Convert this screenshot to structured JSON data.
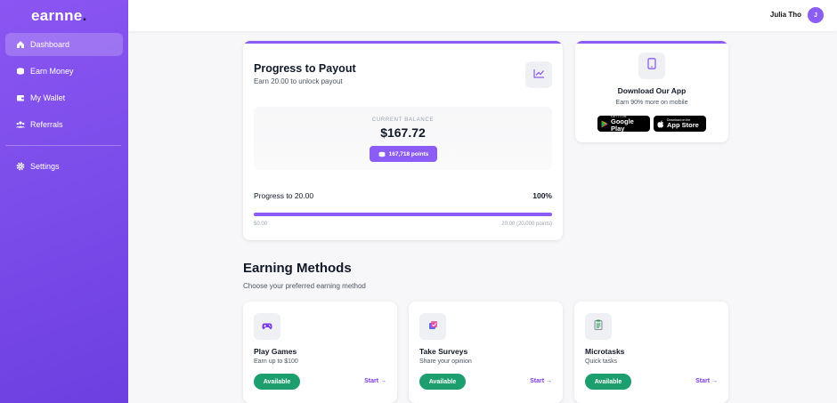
{
  "brand": {
    "name": "earnne",
    "dot": ".",
    "accent": "#8b5cf6",
    "success": "#1d9e6f"
  },
  "sidebar": {
    "items": [
      {
        "label": "Dashboard",
        "icon": "home-icon",
        "active": true
      },
      {
        "label": "Earn Money",
        "icon": "coins-icon",
        "active": false
      },
      {
        "label": "My Wallet",
        "icon": "wallet-icon",
        "active": false
      },
      {
        "label": "Referrals",
        "icon": "users-icon",
        "active": false
      },
      {
        "label": "Settings",
        "icon": "gear-icon",
        "active": false
      }
    ]
  },
  "header": {
    "user_name": "Julia Tho",
    "avatar_initial": "J"
  },
  "payout": {
    "title": "Progress to Payout",
    "subtitle": "Earn 20.00 to unlock payout",
    "balance_label": "CURRENT BALANCE",
    "balance_value": "$167.72",
    "points": "167,718 points",
    "progress_label": "Progress to 20.00",
    "progress_percent": "100%",
    "progress_fraction": 1.0,
    "range_min": "$0.00",
    "range_max": "20.00 (20,000 points)"
  },
  "app": {
    "title": "Download Our App",
    "subtitle": "Earn 90% more on mobile",
    "google_small": "GET IT ON",
    "google_big": "Google Play",
    "apple_small": "Download on the",
    "apple_big": "App Store"
  },
  "methods": {
    "title": "Earning Methods",
    "subtitle": "Choose your preferred earning method",
    "items": [
      {
        "title": "Play Games",
        "subtitle": "Earn up to $100",
        "badge": "Available",
        "action": "Start →",
        "icon": "gamepad-icon"
      },
      {
        "title": "Take Surveys",
        "subtitle": "Share your opinion",
        "badge": "Available",
        "action": "Start →",
        "icon": "survey-icon"
      },
      {
        "title": "Microtasks",
        "subtitle": "Quick tasks",
        "badge": "Available",
        "action": "Start →",
        "icon": "clipboard-icon"
      }
    ]
  }
}
